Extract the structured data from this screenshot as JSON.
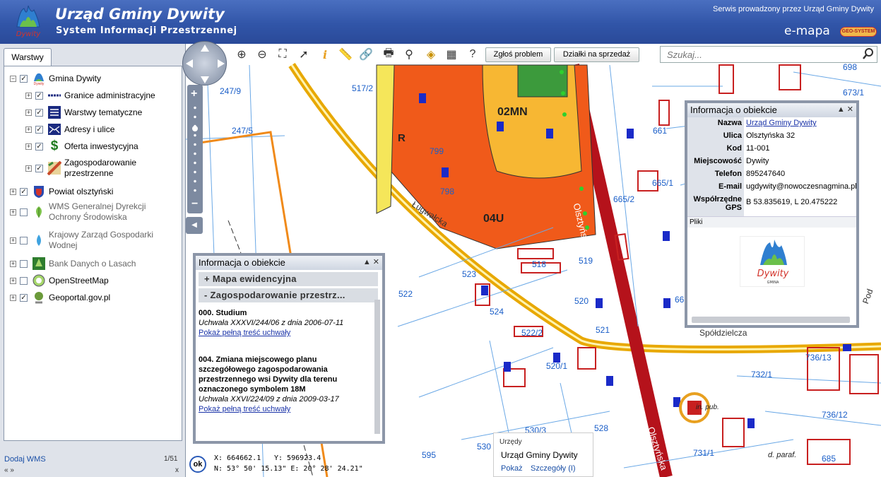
{
  "header": {
    "title": "Urząd Gminy Dywity",
    "subtitle": "System Informacji Przestrzennej",
    "service": "Serwis prowadzony przez Urząd Gminy Dywity",
    "brand": "e-mapa",
    "brand_badge": "GEO-SYSTEM",
    "logo_text": "Dywity"
  },
  "left_panel": {
    "tab": "Warstwy",
    "layers": [
      {
        "label": "Gmina Dywity",
        "checked": true
      },
      {
        "label": "Granice administracyjne",
        "checked": true
      },
      {
        "label": "Warstwy tematyczne",
        "checked": true
      },
      {
        "label": "Adresy i ulice",
        "checked": true
      },
      {
        "label": "Oferta inwestycyjna",
        "checked": true
      },
      {
        "label": "Zagospodarowanie przestrzenne",
        "checked": true
      },
      {
        "label": "Powiat olsztyński",
        "checked": true
      },
      {
        "label": "WMS Generalnej Dyrekcji Ochrony Środowiska",
        "checked": false
      },
      {
        "label": "Krajowy Zarząd Gospodarki Wodnej",
        "checked": false
      },
      {
        "label": "Bank Danych o Lasach",
        "checked": false
      },
      {
        "label": "OpenStreetMap",
        "checked": false
      },
      {
        "label": "Geoportal.gov.pl",
        "checked": true
      }
    ],
    "add_wms": "Dodaj WMS",
    "page": "1/51",
    "nav_arrows": "« »",
    "close": "x"
  },
  "toolbar": {
    "report": "Zgłoś problem",
    "plots_sale": "Działki na sprzedaż",
    "search_placeholder": "Szukaj..."
  },
  "popup_left": {
    "title": "Informacja o obiekcie",
    "sections": [
      "Mapa ewidencyjna",
      "Zagospodarowanie przestrz..."
    ],
    "entries": [
      {
        "title": "000. Studium",
        "resolution": "Uchwała XXXVI/244/06 z dnia 2006-07-11",
        "link": "Pokaż pełną treść uchwały"
      },
      {
        "title": "004. Zmiana miejscowego planu szczegółowego zagospodarowania przestrzennego wsi Dywity dla terenu oznaczonego symbolem 18M",
        "resolution": "Uchwała XXVI/224/09 z dnia 2009-03-17",
        "link": "Pokaż pełną treść uchwały"
      }
    ]
  },
  "popup_right": {
    "title": "Informacja o obiekcie",
    "rows": [
      {
        "key": "Nazwa",
        "value": "Urząd Gminy Dywity"
      },
      {
        "key": "Ulica",
        "value": "Olsztyńska 32"
      },
      {
        "key": "Kod",
        "value": "11-001"
      },
      {
        "key": "Miejscowość",
        "value": "Dywity"
      },
      {
        "key": "Telefon",
        "value": "895247640"
      },
      {
        "key": "E-mail",
        "value": "ugdywity@nowoczesnagmina.pl"
      },
      {
        "key": "Współrzędne GPS",
        "value": "B 53.835619, L 20.475222"
      }
    ],
    "files": "Pliki",
    "logo_text": "Dywity",
    "logo_sub": "GMINA"
  },
  "coords": {
    "x": "X: 664662.1",
    "y": "Y: 596923.4",
    "ne": "N: 53° 50' 15.13\" E: 20° 28' 24.21\"",
    "ok": "ok"
  },
  "urzedy": {
    "label": "Urzędy",
    "name": "Urząd Gminy Dywity",
    "show": "Pokaż",
    "details": "Szczegóły (I)"
  },
  "map_labels": {
    "p247_9": "247/9",
    "p247_5": "247/5",
    "p517_2": "517/2",
    "mn02": "02MN",
    "u04": "04U",
    "p799": "799",
    "p798": "798",
    "p523": "523",
    "p524": "524",
    "p522": "522",
    "p518": "518",
    "p519": "519",
    "p520": "520",
    "p521": "521",
    "p522_2": "522/2",
    "p520_1": "520/1",
    "p528": "528",
    "p530_3": "530/3",
    "p530": "530",
    "p595": "595",
    "p661": "661",
    "p665_1": "665/1",
    "p665_2": "665/2",
    "p732_1": "732/1",
    "p731_1": "731/1",
    "p736_13": "736/13",
    "p736_12": "736/12",
    "p670": "670",
    "p673_1": "673/1",
    "p698": "698",
    "p66": "66",
    "p685": "685",
    "st_olsztynska": "Olsztyńska",
    "st_lugwalcka": "Ługwałcka",
    "st_spoldzielcza": "Spółdzielcza",
    "st_pod": "Pod",
    "st_r": "R",
    "inst": "in. pub.",
    "paraf": "d. paraf.",
    "wm": "geoportal.gov.pl"
  }
}
